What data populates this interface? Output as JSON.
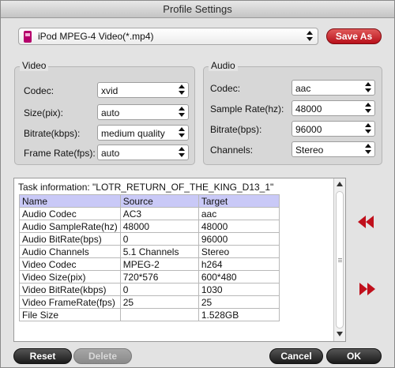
{
  "window": {
    "title": "Profile Settings"
  },
  "profile": {
    "selected": "iPod MPEG-4 Video(*.mp4)",
    "save_as_label": "Save As"
  },
  "video": {
    "legend": "Video",
    "fields": [
      {
        "label": "Codec:",
        "value": "xvid"
      },
      {
        "label": "Size(pix):",
        "value": "auto"
      },
      {
        "label": "Bitrate(kbps):",
        "value": "medium quality"
      },
      {
        "label": "Frame Rate(fps):",
        "value": "auto"
      }
    ]
  },
  "audio": {
    "legend": "Audio",
    "fields": [
      {
        "label": "Codec:",
        "value": "aac"
      },
      {
        "label": "Sample Rate(hz):",
        "value": "48000"
      },
      {
        "label": "Bitrate(bps):",
        "value": "96000"
      },
      {
        "label": "Channels:",
        "value": "Stereo"
      }
    ]
  },
  "task": {
    "title": "Task information: \"LOTR_RETURN_OF_THE_KING_D13_1\"",
    "headers": [
      "Name",
      "Source",
      "Target"
    ],
    "rows": [
      [
        "Audio Codec",
        "AC3",
        "aac"
      ],
      [
        "Audio SampleRate(hz)",
        "48000",
        "48000"
      ],
      [
        "Audio BitRate(bps)",
        "0",
        "96000"
      ],
      [
        "Audio Channels",
        "5.1 Channels",
        "Stereo"
      ],
      [
        "Video Codec",
        "MPEG-2",
        "h264"
      ],
      [
        "Video Size(pix)",
        "720*576",
        "600*480"
      ],
      [
        "Video BitRate(kbps)",
        "0",
        "1030"
      ],
      [
        "Video FrameRate(fps)",
        "25",
        "25"
      ],
      [
        "File Size",
        "",
        "1.528GB"
      ]
    ]
  },
  "buttons": {
    "reset": "Reset",
    "delete": "Delete",
    "cancel": "Cancel",
    "ok": "OK"
  },
  "colors": {
    "accent_red": "#c0101c",
    "table_header": "#c9c9f7"
  },
  "icons": {
    "profile": "ipod-video-icon",
    "prev": "double-chevron-left-icon",
    "next": "double-chevron-right-icon"
  }
}
